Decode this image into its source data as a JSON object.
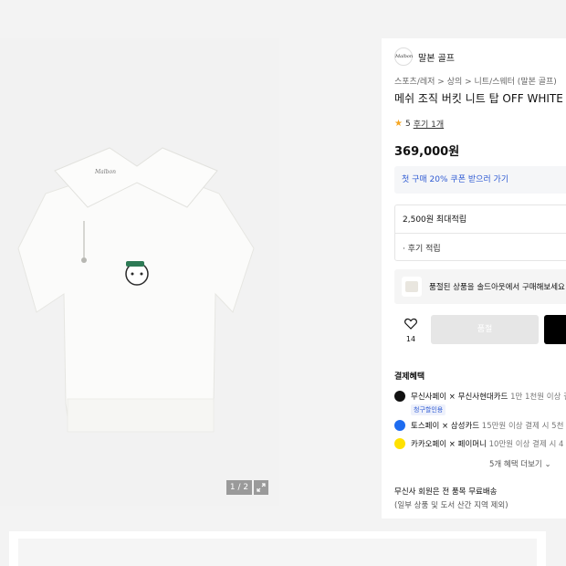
{
  "gallery": {
    "image_alt": "product-photo",
    "counter": "1 / 2",
    "shirt_logo": "Malbon"
  },
  "brand": {
    "logo_text": "Malbon",
    "name": "말본 골프"
  },
  "breadcrumb": "스포츠/레저 > 상의 > 니트/스웨터 (말본 골프)",
  "product": {
    "title": "메쉬 조직 버킷 니트 탑 OFF WHITE (",
    "rating": "5",
    "review_link": "후기 1개",
    "price": "369,000원"
  },
  "coupon": {
    "text": "첫 구매 20% 쿠폰 받으러 가기"
  },
  "points": {
    "max": "2,500원 최대적립",
    "review": "· 후기 적립"
  },
  "soldout": {
    "text": "품절된 상품을 솔드아웃에서 구매해보세요"
  },
  "actions": {
    "like_count": "14",
    "cart_label": "품절"
  },
  "benefits": {
    "title": "결제혜택",
    "items": [
      {
        "name": "무신사페이 × 무신사현대카드",
        "detail": "1만 1천원 이상 결",
        "tag": "청구할인용"
      },
      {
        "name": "토스페이 × 삼성카드",
        "detail": "15만원 이상 결제 시 5천"
      },
      {
        "name": "카카오페이 × 페이머니",
        "detail": "10만원 이상 결제 시 4"
      }
    ],
    "more": "5개 혜택 더보기",
    "colors": [
      "#111111",
      "#1e6cf0",
      "#ffe100"
    ]
  },
  "shipping": {
    "line1": "무신사 회원은 전 품목 무료배송",
    "line2": "(일부 상품 및 도서 산간 지역 제외)"
  }
}
